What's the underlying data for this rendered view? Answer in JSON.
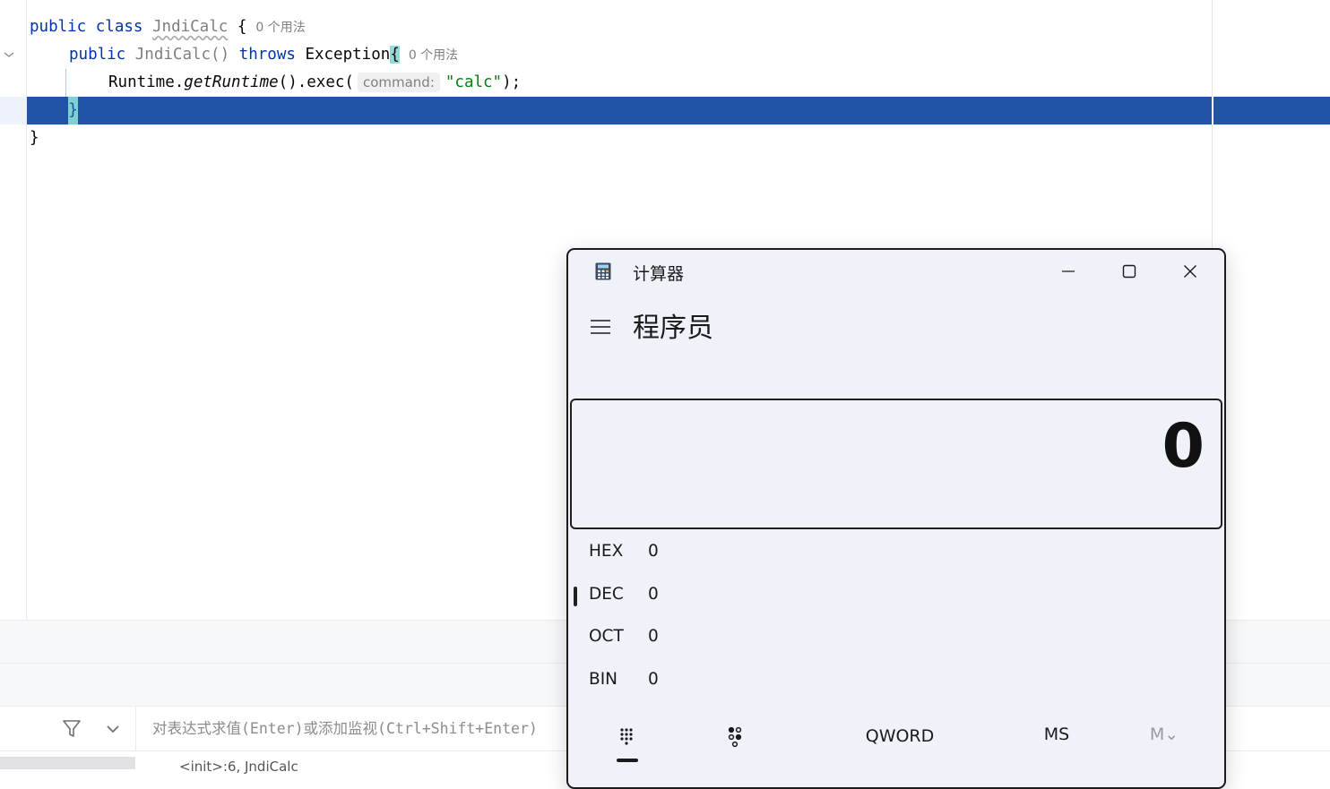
{
  "editor": {
    "line1": {
      "kw_public": "public",
      "kw_class": "class",
      "class_name": "JndiCalc",
      "brace": "{",
      "usage": "0 个用法"
    },
    "line2": {
      "kw_public": "public",
      "ctor": "JndiCalc()",
      "kw_throws": "throws",
      "exception": "Exception",
      "brace": "{",
      "usage": "0 个用法"
    },
    "line3": {
      "prefix": "Runtime.",
      "method": "getRuntime",
      "middle": "().exec(",
      "hint": "command:",
      "arg": "\"calc\"",
      "suffix": ");"
    },
    "line4": {
      "brace": "}"
    },
    "line5": {
      "brace": "}"
    }
  },
  "debugger": {
    "eval_placeholder": "对表达式求值(Enter)或添加监视(Ctrl+Shift+Enter)",
    "frame_text": "<init>:6, JndiCalc"
  },
  "calculator": {
    "window_title": "计算器",
    "mode": "程序员",
    "display": "0",
    "radix": [
      {
        "name": "HEX",
        "value": "0"
      },
      {
        "name": "DEC",
        "value": "0"
      },
      {
        "name": "OCT",
        "value": "0"
      },
      {
        "name": "BIN",
        "value": "0"
      }
    ],
    "word_size": "QWORD",
    "memory_store": "MS",
    "memory_menu": "M⌄"
  }
}
